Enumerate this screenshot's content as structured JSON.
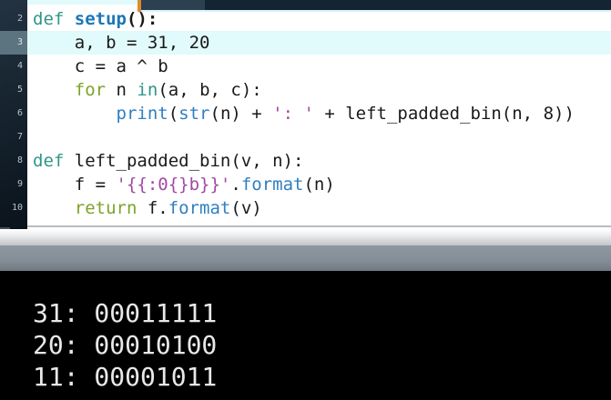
{
  "palette": {
    "keyword_teal": "#2e9688",
    "keyword_olive": "#7da32a",
    "function_blue": "#2f7fc1",
    "defname_blue": "#1c77b5",
    "string_purple": "#a149a5",
    "plain_text": "#1a1a1a",
    "line_highlight_cyan": "#e1fafc",
    "gutter_active_slate": "#5b7480",
    "line_number_grey": "#b9c4cb",
    "marker_orange": "#df8a2e",
    "scroll_thumb_slate": "#2b4150",
    "scroll_track_navy": "#132433",
    "terminal_text": "#e8e8e8"
  },
  "editor": {
    "active_line": 3,
    "lines": [
      {
        "num": 2,
        "tokens": [
          {
            "t": "def",
            "s": "kw"
          },
          {
            "t": " ",
            "s": "plain"
          },
          {
            "t": "setup",
            "s": "defname"
          },
          {
            "t": "():",
            "s": "plainbold"
          }
        ]
      },
      {
        "num": 3,
        "tokens": [
          {
            "t": "    a, b = 31, 20",
            "s": "plain"
          }
        ]
      },
      {
        "num": 4,
        "tokens": [
          {
            "t": "    c = a ^ b",
            "s": "plain"
          }
        ]
      },
      {
        "num": 5,
        "tokens": [
          {
            "t": "    ",
            "s": "plain"
          },
          {
            "t": "for",
            "s": "kw2"
          },
          {
            "t": " n ",
            "s": "plain"
          },
          {
            "t": "in",
            "s": "kw"
          },
          {
            "t": "(a, b, c):",
            "s": "plain"
          }
        ]
      },
      {
        "num": 6,
        "tokens": [
          {
            "t": "        ",
            "s": "plain"
          },
          {
            "t": "print",
            "s": "func"
          },
          {
            "t": "(",
            "s": "plain"
          },
          {
            "t": "str",
            "s": "func"
          },
          {
            "t": "(n) + ",
            "s": "plain"
          },
          {
            "t": "': '",
            "s": "str"
          },
          {
            "t": " + left_padded_bin(n, 8))",
            "s": "plain"
          }
        ]
      },
      {
        "num": 7,
        "tokens": []
      },
      {
        "num": 8,
        "tokens": [
          {
            "t": "def",
            "s": "kw"
          },
          {
            "t": " left_padded_bin(v, n):",
            "s": "plain"
          }
        ]
      },
      {
        "num": 9,
        "tokens": [
          {
            "t": "    f = ",
            "s": "plain"
          },
          {
            "t": "'{{:0{}b}}'",
            "s": "str"
          },
          {
            "t": ".",
            "s": "plain"
          },
          {
            "t": "format",
            "s": "func"
          },
          {
            "t": "(n)",
            "s": "plain"
          }
        ]
      },
      {
        "num": 10,
        "tokens": [
          {
            "t": "    ",
            "s": "plain"
          },
          {
            "t": "return",
            "s": "kw2"
          },
          {
            "t": " f.",
            "s": "plain"
          },
          {
            "t": "format",
            "s": "func"
          },
          {
            "t": "(v)",
            "s": "plain"
          }
        ]
      }
    ]
  },
  "terminal": {
    "lines": [
      "31: 00011111",
      "20: 00010100",
      "11: 00001011"
    ]
  }
}
